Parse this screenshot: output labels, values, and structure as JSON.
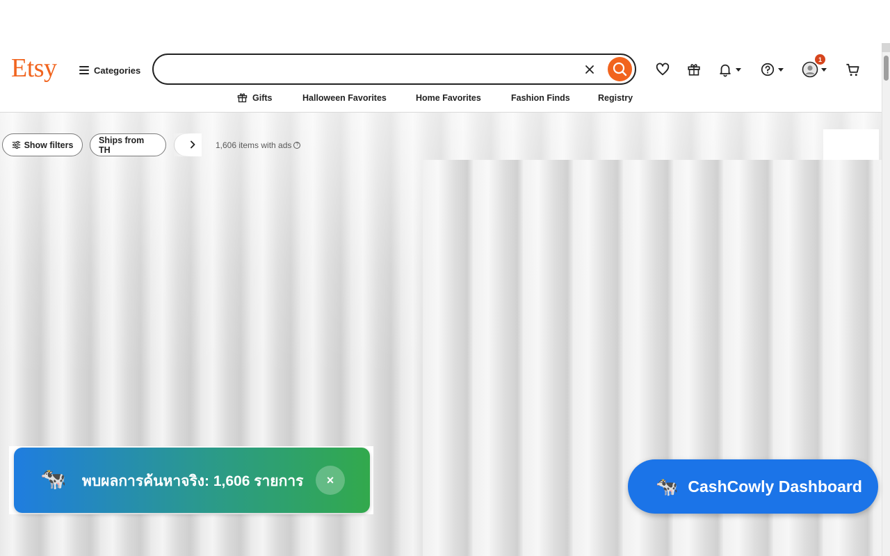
{
  "header": {
    "logo": "Etsy",
    "categories_label": "Categories",
    "search": {
      "value": "",
      "placeholder": ""
    },
    "notifications_badge": "1"
  },
  "nav": {
    "items": [
      "Gifts",
      "Halloween Favorites",
      "Home Favorites",
      "Fashion Finds",
      "Registry"
    ]
  },
  "filters": {
    "show_filters_label": "Show filters",
    "ships_from_label": "Ships from TH",
    "results_count": "1,606 items with ads"
  },
  "toast": {
    "emoji": "🐄",
    "message": "พบผลการค้นหาจริง: 1,606 รายการ",
    "close_label": "×"
  },
  "dashboard_button": {
    "emoji": "🐄",
    "label": "CashCowly Dashboard"
  },
  "colors": {
    "brand": "#f1641e",
    "badge": "#d6451d",
    "dashboard": "#1b74e8",
    "toast_start": "#1f7de0",
    "toast_end": "#32a94c"
  },
  "icons": [
    "menu-icon",
    "clear-icon",
    "search-icon",
    "heart-icon",
    "gift-icon",
    "bell-icon",
    "help-icon",
    "account-icon",
    "cart-icon",
    "filter-icon",
    "chevron-right-icon",
    "info-icon"
  ]
}
